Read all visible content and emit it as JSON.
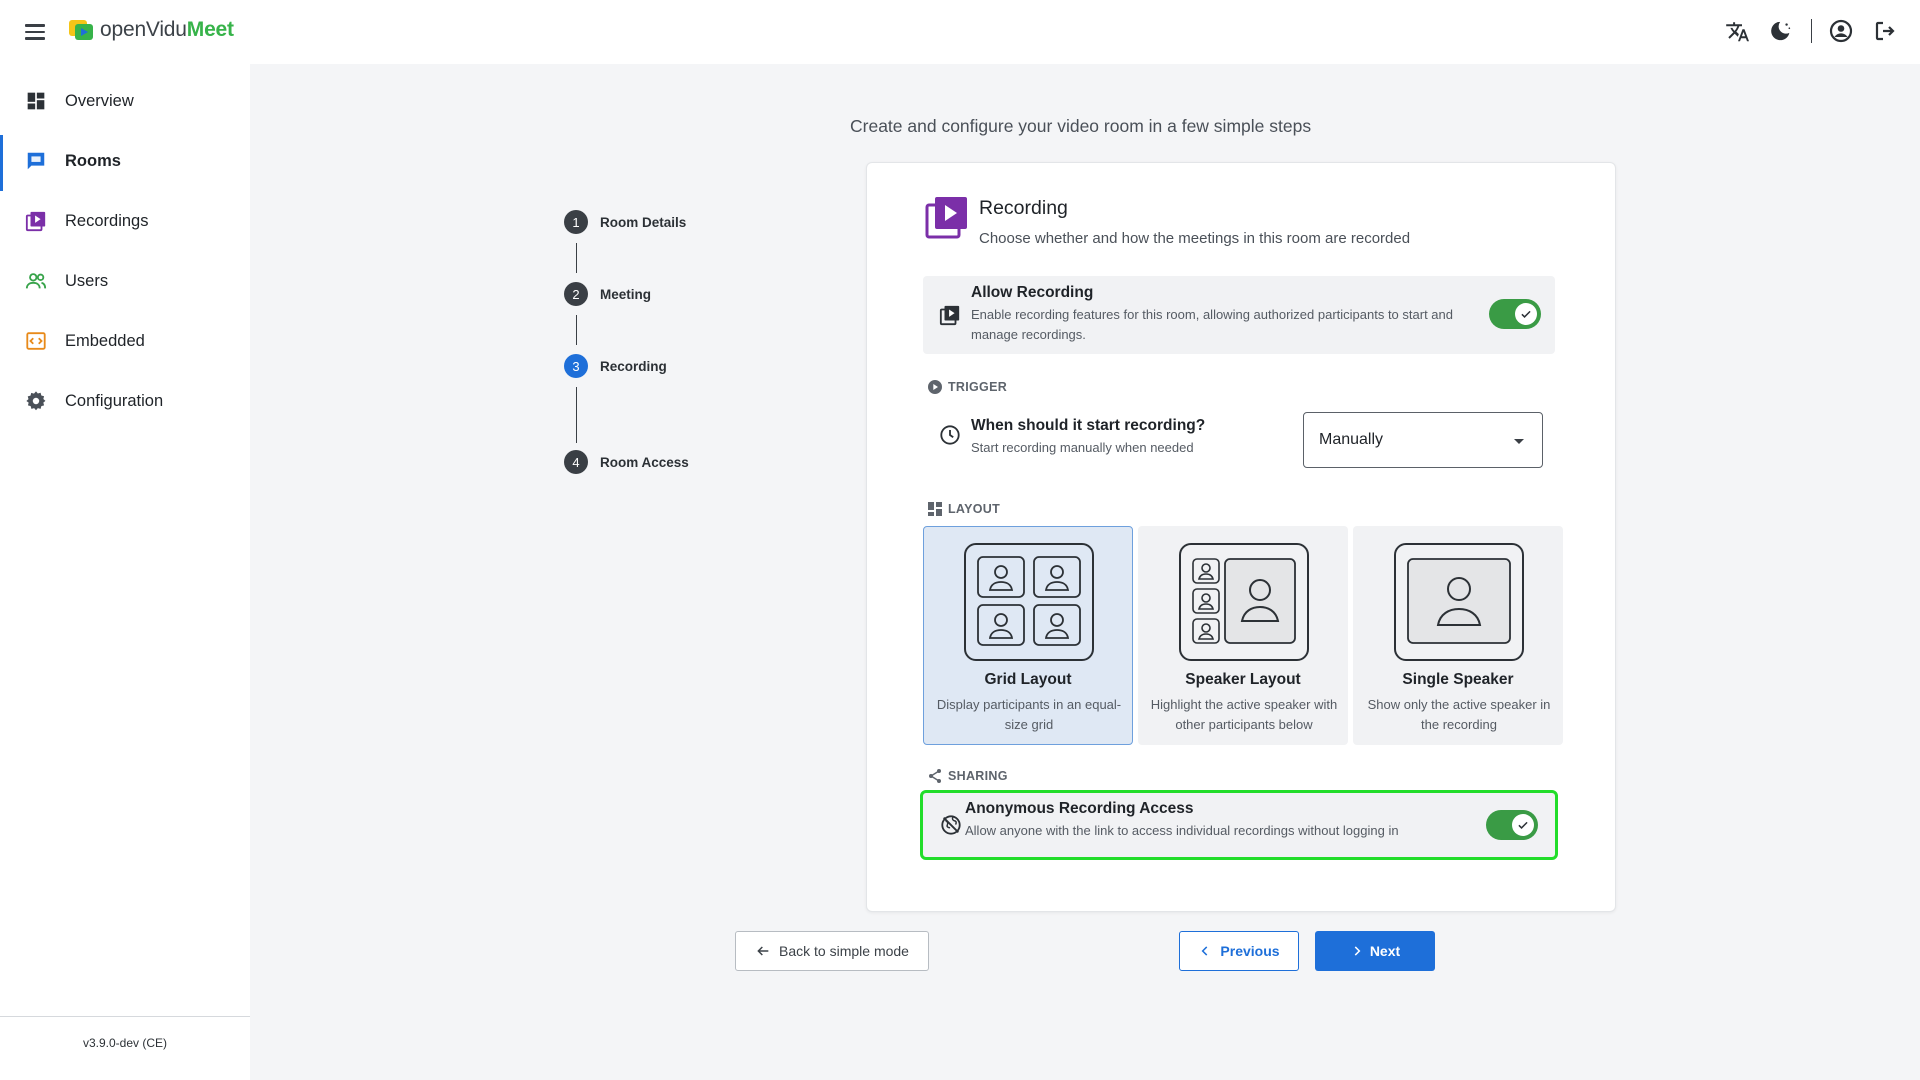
{
  "app": {
    "brand_prefix": "openVidu",
    "brand_suffix": "Meet"
  },
  "sidebar": {
    "items": [
      {
        "label": "Overview",
        "icon": "dashboard-icon"
      },
      {
        "label": "Rooms",
        "icon": "chat-icon",
        "active": true
      },
      {
        "label": "Recordings",
        "icon": "video-library-icon"
      },
      {
        "label": "Users",
        "icon": "users-icon"
      },
      {
        "label": "Embedded",
        "icon": "code-icon"
      },
      {
        "label": "Configuration",
        "icon": "gear-icon"
      }
    ],
    "version": "v3.9.0-dev (CE)"
  },
  "main": {
    "subtitle": "Create and configure your video room in a few simple steps",
    "steps": [
      {
        "num": "1",
        "label": "Room Details"
      },
      {
        "num": "2",
        "label": "Meeting"
      },
      {
        "num": "3",
        "label": "Recording",
        "current": true
      },
      {
        "num": "4",
        "label": "Room Access"
      }
    ]
  },
  "recording": {
    "title": "Recording",
    "description": "Choose whether and how the meetings in this room are recorded",
    "allow": {
      "title": "Allow Recording",
      "description": "Enable recording features for this room, allowing authorized participants to start and manage recordings.",
      "enabled": true
    },
    "trigger": {
      "section": "TRIGGER",
      "question": "When should it start recording?",
      "hint": "Start recording manually when needed",
      "selected": "Manually"
    },
    "layout": {
      "section": "LAYOUT",
      "options": [
        {
          "title": "Grid Layout",
          "description": "Display participants in an equal-size grid",
          "selected": true
        },
        {
          "title": "Speaker Layout",
          "description": "Highlight the active speaker with other participants below"
        },
        {
          "title": "Single Speaker",
          "description": "Show only the active speaker in the recording"
        }
      ]
    },
    "sharing": {
      "section": "SHARING",
      "title": "Anonymous Recording Access",
      "description": "Allow anyone with the link to access individual recordings without logging in",
      "enabled": true
    }
  },
  "footer": {
    "back_label": "Back to simple mode",
    "prev_label": "Previous",
    "next_label": "Next"
  },
  "colors": {
    "accent": "#1e6fd9",
    "toggle_on": "#3a9b45",
    "highlight": "#22dd2a",
    "brand_green": "#37b34a"
  }
}
